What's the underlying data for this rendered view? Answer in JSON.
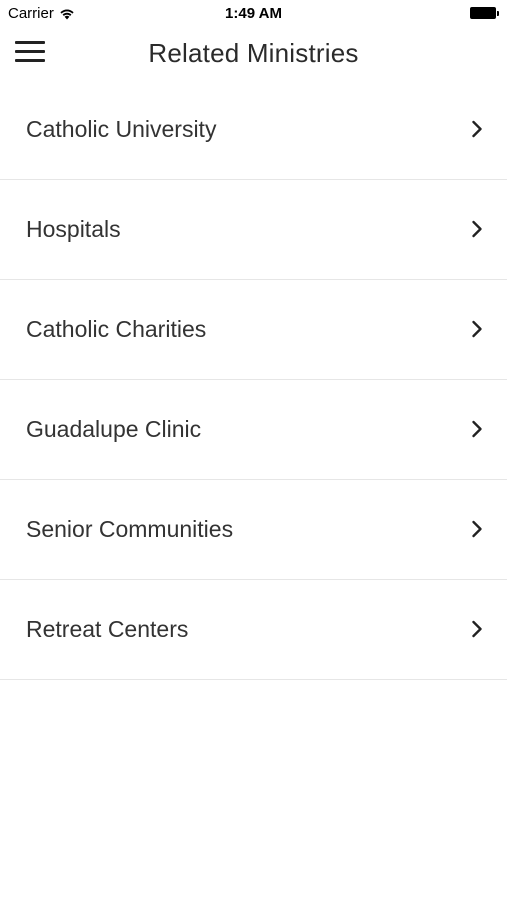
{
  "status_bar": {
    "carrier": "Carrier",
    "time": "1:49 AM"
  },
  "nav": {
    "title": "Related Ministries",
    "menu_icon": "hamburger-menu-icon"
  },
  "items": [
    {
      "label": "Catholic University",
      "icon": "chevron-right-icon"
    },
    {
      "label": "Hospitals",
      "icon": "chevron-right-icon"
    },
    {
      "label": "Catholic Charities",
      "icon": "chevron-right-icon"
    },
    {
      "label": "Guadalupe Clinic",
      "icon": "chevron-right-icon"
    },
    {
      "label": "Senior Communities",
      "icon": "chevron-right-icon"
    },
    {
      "label": "Retreat Centers",
      "icon": "chevron-right-icon"
    }
  ]
}
